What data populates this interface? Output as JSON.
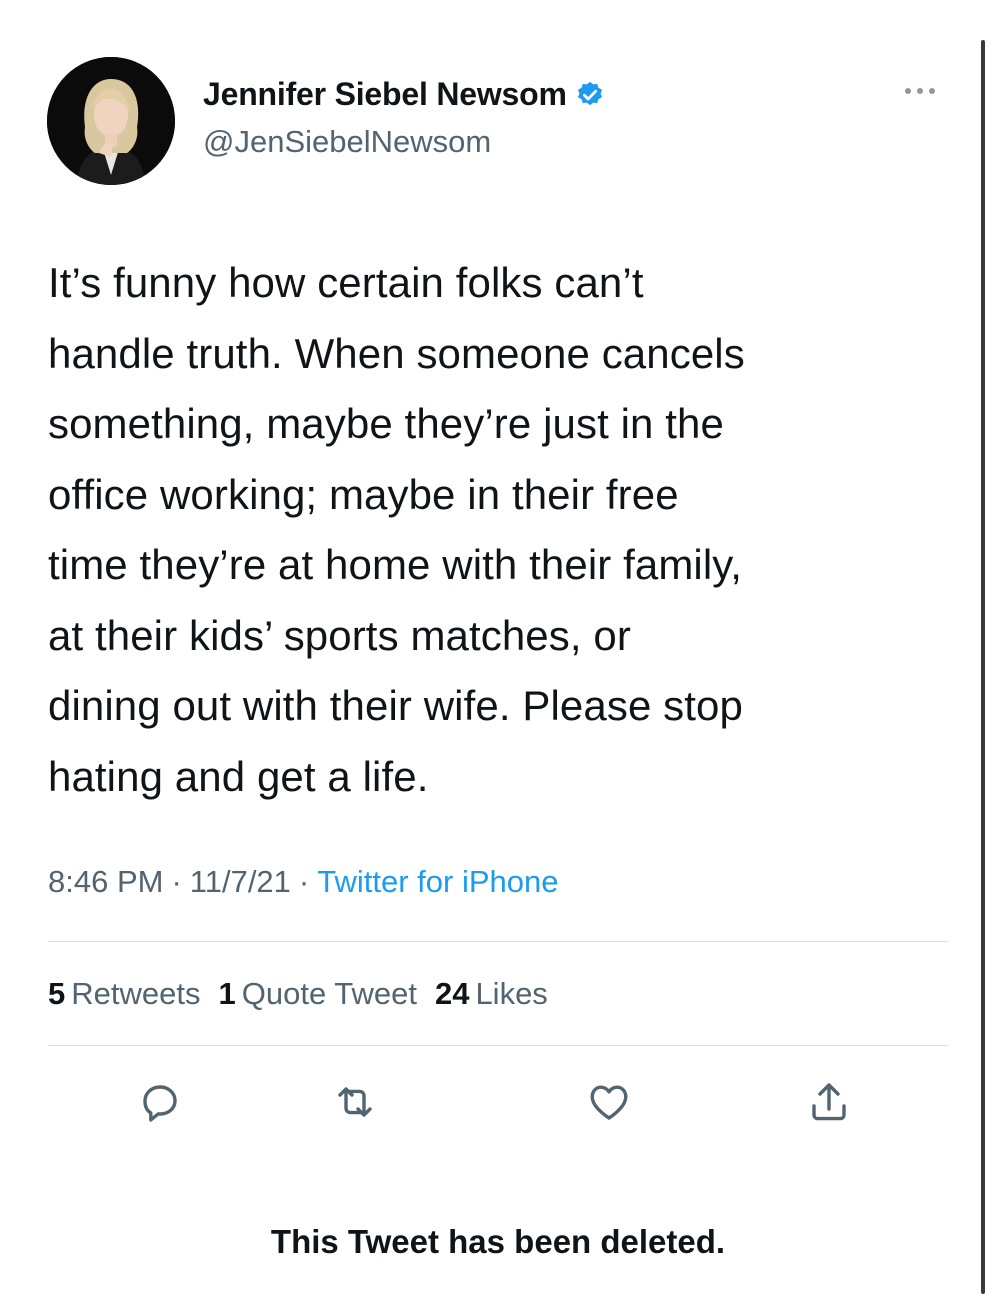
{
  "author": {
    "display_name": "Jennifer Siebel Newsom",
    "handle": "@JenSiebelNewsom",
    "verified": true,
    "avatar_icon": "profile-photo"
  },
  "tweet": {
    "text": "It’s funny how certain folks can’t\nhandle truth. When someone cancels\nsomething, maybe they’re just in the\noffice working; maybe in their free\ntime they’re at home with their family,\nat their kids’ sports matches, or\ndining out with their wife. Please stop\nhating and get a life."
  },
  "meta": {
    "time": "8:46 PM",
    "separator": "·",
    "date": "11/7/21",
    "source": "Twitter for iPhone"
  },
  "stats": {
    "retweets_count": "5",
    "retweets_label": "Retweets",
    "quote_count": "1",
    "quote_label": "Quote Tweet",
    "likes_count": "24",
    "likes_label": "Likes"
  },
  "actions": [
    "reply-icon",
    "retweet-icon",
    "like-icon",
    "share-icon"
  ],
  "notice": "This Tweet has been deleted.",
  "colors": {
    "text": "#0f1419",
    "secondary": "#536471",
    "link": "#1d9bf0",
    "verified": "#1d9bf0"
  }
}
